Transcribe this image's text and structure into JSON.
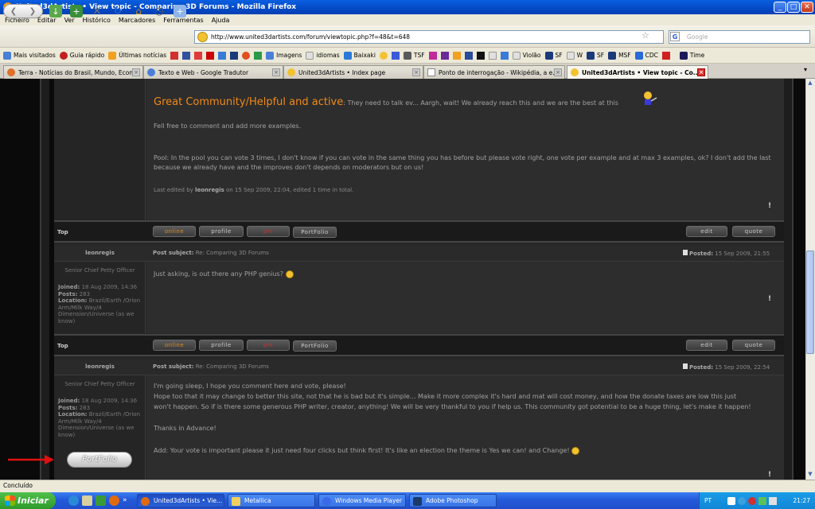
{
  "window": {
    "title": "United3dArtists • View topic - Comparing 3D Forums - Mozilla Firefox",
    "min": "_",
    "max": "□",
    "close": "✕"
  },
  "menu": [
    "Ficheiro",
    "Editar",
    "Ver",
    "Histórico",
    "Marcadores",
    "Ferramentas",
    "Ajuda"
  ],
  "nav": {
    "url": "http://www.united3dartists.com/forum/viewtopic.php?f=48&t=648",
    "search_placeholder": "Google",
    "back": "❮",
    "forward": "❯"
  },
  "bookmarks": [
    "Mais visitados",
    "Guia rápido",
    "Últimas notícias",
    "Imagens",
    "idiomas",
    "Baixaki",
    "TSF",
    "Violão",
    "SF",
    "W",
    "SF",
    "MSF",
    "CDC",
    "Time"
  ],
  "tabs": [
    {
      "label": "Terra - Notícias do Brasil, Mundo, Econ...",
      "icon_color": "#e0702a"
    },
    {
      "label": "Texto e Web - Google Tradutor",
      "icon_color": "#4a7fd8"
    },
    {
      "label": "United3dArtists • Index page",
      "icon_color": "#f2c230"
    },
    {
      "label": "Ponto de interrogação - Wikipédia, a e...",
      "icon_color": "#ffffff"
    },
    {
      "label": "United3dArtists • View topic - Co...",
      "icon_color": "#f2c230"
    }
  ],
  "post1": {
    "heading": "Great Community/Helpful and active",
    "heading_tail": ": They need to talk ev... Aargh, wait! We already reach this and we are the best at this",
    "line1": "Fell free to comment and add more examples.",
    "poll": "Pool: In the pool you can vote 3 times, I don't know if you can vote in the same thing you has before but please vote right, one vote per example and at max 3 examples, ok? I don't add the last because we already have and the improves don't depends on moderators but on us!",
    "edited_pre": "Last edited by ",
    "edited_user": "leonregis",
    "edited_post": " on 15 Sep 2009, 22:04, edited 1 time in total."
  },
  "actions": {
    "top": "Top",
    "online": "online",
    "profile": "profile",
    "pm": "pm",
    "portfolio": "PortFolio",
    "edit": "edit",
    "quote": "quote",
    "excl": "!"
  },
  "post2": {
    "author": "leonregis",
    "rank": "Senior Chief Petty Officer",
    "subject_label": "Post subject:",
    "subject": "Re: Comparing 3D Forums",
    "posted_label": "Posted:",
    "posted": "15 Sep 2009, 21:55",
    "body": "Just asking, is out there any PHP genius?",
    "joined_label": "Joined:",
    "joined": "18 Aug 2009, 14:36",
    "posts_label": "Posts:",
    "posts": "283",
    "location_label": "Location:",
    "location": "Brazil/Earth /Orion Arm/Milk Way/4 Dimension/Universe (as we know)"
  },
  "post3": {
    "author": "leonregis",
    "rank": "Senior Chief Petty Officer",
    "subject_label": "Post subject:",
    "subject": "Re: Comparing 3D Forums",
    "posted_label": "Posted:",
    "posted": "15 Sep 2009, 22:54",
    "l1": "I'm going sleep, I hope you comment here and vote, please!",
    "l2": "Hope too that it may change to better this site, not that he is bad but it's simple... Make it more complex it's hard and mat will cost money, and how the donate taxes are low this just",
    "l3": "won't happen. So if is there some generous PHP writer, creator, anything! We will be very thankful to you if help us. This community got potential to be a huge thing, let's make it happen!",
    "l4": "Thanks in Advance!",
    "l5": "Add: Your vote is important please it just need four clicks but think first! It's like an election the theme is Yes we can! and Change!",
    "joined_label": "Joined:",
    "joined": "18 Aug 2009, 14:36",
    "posts_label": "Posts:",
    "posts": "283",
    "location_label": "Location:",
    "location": "Brazil/Earth /Orion Arm/Milk Way/4 Dimension/Universe (as we know)",
    "portfolio_badge": "PortFolio"
  },
  "status": "Concluído",
  "taskbar": {
    "start": "Iniciar",
    "items": [
      "United3dArtists • Vie...",
      "Metallica",
      "Windows Media Player",
      "Adobe Photoshop"
    ],
    "lang": "PT",
    "time": "21:27"
  }
}
